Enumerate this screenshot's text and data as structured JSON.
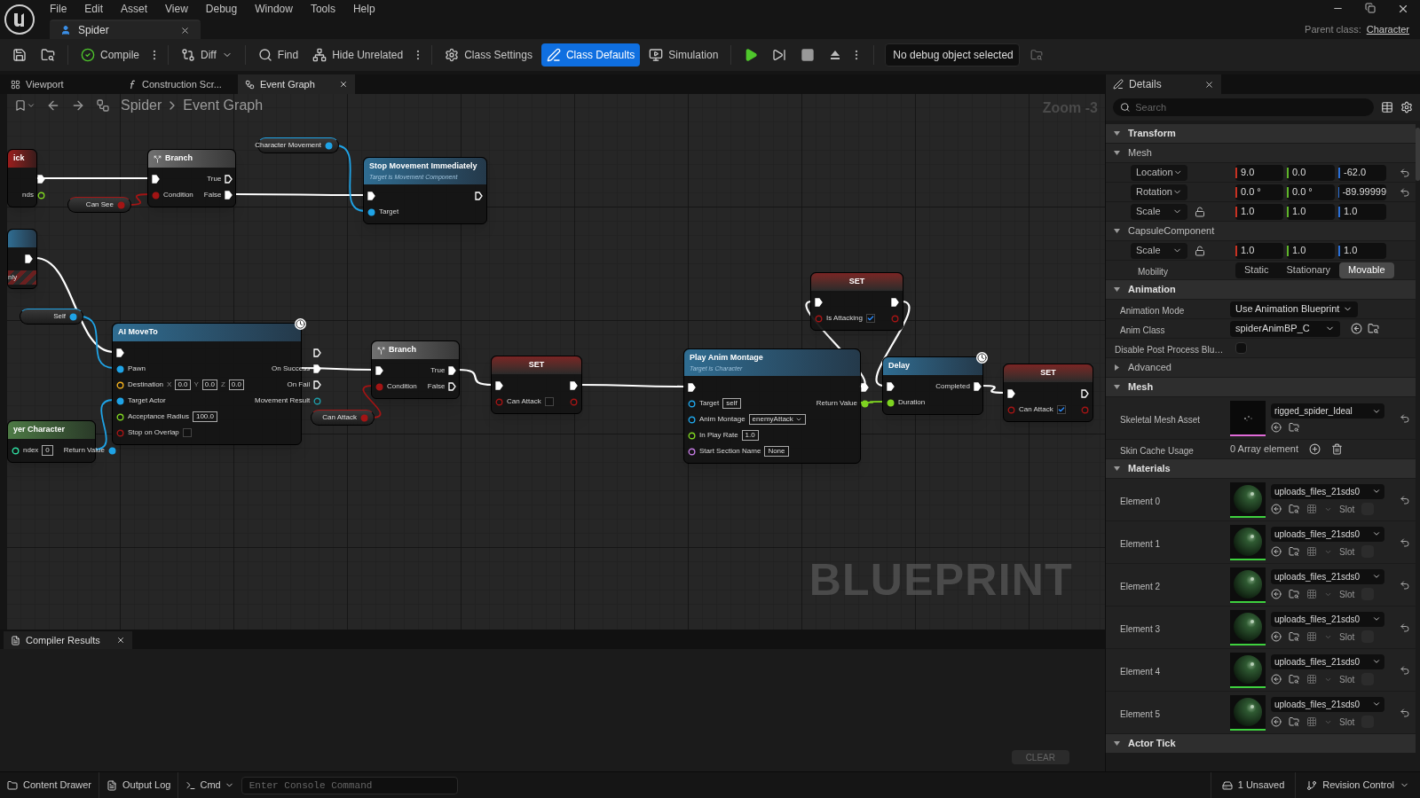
{
  "menu": [
    "File",
    "Edit",
    "Asset",
    "View",
    "Debug",
    "Window",
    "Tools",
    "Help"
  ],
  "document_tab": {
    "title": "Spider"
  },
  "parent_class": {
    "label": "Parent class:",
    "value": "Character"
  },
  "toolbar": {
    "buttons": [
      {
        "kind": "save",
        "active": false
      },
      {
        "kind": "browse",
        "active": false
      },
      {
        "kind": "compile",
        "label": "Compile",
        "active": false,
        "menu": true
      },
      {
        "kind": "diff",
        "label": "Diff",
        "active": false,
        "dropdown": true
      },
      {
        "kind": "find",
        "label": "Find",
        "active": false
      },
      {
        "kind": "hide",
        "label": "Hide Unrelated",
        "active": false,
        "menu": true
      },
      {
        "kind": "settings",
        "label": "Class Settings",
        "active": false
      },
      {
        "kind": "defaults",
        "label": "Class Defaults",
        "active": true
      },
      {
        "kind": "simulation",
        "label": "Simulation",
        "active": false
      },
      {
        "kind": "play",
        "active": false
      },
      {
        "kind": "step",
        "active": false
      },
      {
        "kind": "stop",
        "active": false
      },
      {
        "kind": "eject",
        "active": false,
        "menu": true
      }
    ],
    "debug_object": "No debug object selected"
  },
  "editor_tabs": [
    {
      "kind": "viewport",
      "label": "Viewport",
      "selected": false
    },
    {
      "kind": "function",
      "label": "Construction Scr...",
      "selected": false
    },
    {
      "kind": "graph",
      "label": "Event Graph",
      "selected": true,
      "closable": true
    }
  ],
  "graph": {
    "breadcrumb": [
      "Spider",
      "Event Graph"
    ],
    "zoom": "Zoom -3",
    "watermark": "BLUEPRINT",
    "nodes": [
      {
        "kind": "event",
        "title": "ick",
        "outputs": [
          {
            "kind": "exec",
            "linked": true
          },
          {
            "kind": "float",
            "label": "nds",
            "linked": false
          }
        ]
      },
      {
        "kind": "branch",
        "title": "Branch",
        "inputs": [
          {
            "kind": "exec",
            "linked": true
          },
          {
            "kind": "bool",
            "label": "Condition",
            "linked": true
          }
        ],
        "outputs": [
          {
            "kind": "exec",
            "label": "True",
            "linked": false
          },
          {
            "kind": "exec",
            "label": "False",
            "linked": true
          }
        ]
      },
      {
        "kind": "variable",
        "title": "Character Movement",
        "outputs": [
          {
            "kind": "object",
            "linked": true
          }
        ]
      },
      {
        "kind": "function",
        "title": "Stop Movement Immediately",
        "subtitle": "Target is Movement Component",
        "inputs": [
          {
            "kind": "exec",
            "linked": true
          },
          {
            "kind": "object",
            "label": "Target",
            "linked": true
          }
        ],
        "outputs": [
          {
            "kind": "exec",
            "linked": false
          }
        ]
      },
      {
        "kind": "variable",
        "title": "Can See",
        "outputs": [
          {
            "kind": "bool",
            "linked": true
          }
        ]
      },
      {
        "kind": "function",
        "banner": "nly",
        "outputs": [
          {
            "kind": "exec",
            "linked": true
          }
        ]
      },
      {
        "kind": "variable",
        "title": "Self",
        "outputs": [
          {
            "kind": "object",
            "linked": true
          }
        ]
      },
      {
        "kind": "function",
        "title": "AI MoveTo",
        "latent": true,
        "inputs": [
          {
            "kind": "exec",
            "linked": true
          },
          {
            "kind": "object",
            "label": "Pawn",
            "linked": true
          },
          {
            "kind": "vector",
            "label": "Destination",
            "linked": false,
            "values": [
              {
                "axis": "X",
                "value": "0.0"
              },
              {
                "axis": "Y",
                "value": "0.0"
              },
              {
                "axis": "Z",
                "value": "0.0"
              }
            ]
          },
          {
            "kind": "object",
            "label": "Target Actor",
            "linked": true
          },
          {
            "kind": "float",
            "label": "Acceptance Radius",
            "linked": false,
            "value": "100.0"
          },
          {
            "kind": "bool",
            "label": "Stop on Overlap",
            "linked": false,
            "checked": false
          }
        ],
        "outputs": [
          {
            "kind": "exec",
            "linked": false
          },
          {
            "kind": "exec",
            "label": "On Success",
            "linked": true
          },
          {
            "kind": "exec",
            "label": "On Fail",
            "linked": false
          },
          {
            "kind": "enum",
            "label": "Movement Result",
            "linked": false
          }
        ]
      },
      {
        "kind": "pure",
        "title": "yer Character",
        "inputs": [
          {
            "kind": "int",
            "label": "ndex",
            "linked": false,
            "value": "0"
          }
        ],
        "outputs": [
          {
            "kind": "object",
            "label": "Return Value",
            "linked": true
          }
        ]
      },
      {
        "kind": "variable",
        "title": "Can Attack",
        "outputs": [
          {
            "kind": "bool",
            "linked": true
          }
        ]
      },
      {
        "kind": "branch",
        "title": "Branch",
        "inputs": [
          {
            "kind": "exec",
            "linked": true
          },
          {
            "kind": "bool",
            "label": "Condition",
            "linked": true
          }
        ],
        "outputs": [
          {
            "kind": "exec",
            "label": "True",
            "linked": true
          },
          {
            "kind": "exec",
            "label": "False",
            "linked": false
          }
        ]
      },
      {
        "kind": "set",
        "title": "SET",
        "inputs": [
          {
            "kind": "exec",
            "linked": true
          },
          {
            "kind": "bool",
            "label": "Can Attack",
            "linked": false,
            "checked": false
          }
        ],
        "outputs": [
          {
            "kind": "exec",
            "linked": true
          },
          {
            "kind": "bool",
            "linked": false
          }
        ]
      },
      {
        "kind": "set",
        "title": "SET",
        "inputs": [
          {
            "kind": "exec",
            "linked": true
          },
          {
            "kind": "bool",
            "label": "Is Attacking",
            "linked": false,
            "checked": true
          }
        ],
        "outputs": [
          {
            "kind": "exec",
            "linked": true
          },
          {
            "kind": "bool",
            "linked": false
          }
        ]
      },
      {
        "kind": "function",
        "title": "Play Anim Montage",
        "subtitle": "Target is Character",
        "inputs": [
          {
            "kind": "exec",
            "linked": true
          },
          {
            "kind": "object",
            "label": "Target",
            "linked": false,
            "value": "self"
          },
          {
            "kind": "object",
            "label": "Anim Montage",
            "linked": false,
            "value": "enemyAttack",
            "picker": true
          },
          {
            "kind": "float",
            "label": "In Play Rate",
            "linked": false,
            "value": "1.0"
          },
          {
            "kind": "name",
            "label": "Start Section Name",
            "linked": false,
            "value": "None"
          }
        ],
        "outputs": [
          {
            "kind": "exec",
            "linked": true
          },
          {
            "kind": "float",
            "label": "Return Value",
            "linked": true
          }
        ]
      },
      {
        "kind": "function",
        "title": "Delay",
        "latent": true,
        "inputs": [
          {
            "kind": "exec",
            "linked": true
          },
          {
            "kind": "float",
            "label": "Duration",
            "linked": true
          }
        ],
        "outputs": [
          {
            "kind": "exec",
            "label": "Completed",
            "linked": true
          }
        ]
      },
      {
        "kind": "set",
        "title": "SET",
        "inputs": [
          {
            "kind": "exec",
            "linked": true
          },
          {
            "kind": "bool",
            "label": "Can Attack",
            "linked": false,
            "checked": true
          }
        ],
        "outputs": [
          {
            "kind": "exec",
            "linked": false
          },
          {
            "kind": "bool",
            "linked": false
          }
        ]
      }
    ]
  },
  "bottom_panel": {
    "tab": "Compiler Results",
    "clear": "CLEAR"
  },
  "details": {
    "title": "Details",
    "search_placeholder": "Search",
    "sections": [
      {
        "kind": "category",
        "title": "Transform",
        "expanded": true
      },
      {
        "kind": "group",
        "title": "Mesh",
        "expanded": true,
        "rows": [
          {
            "kind": "vector",
            "label": "Location",
            "values": [
              "9.0",
              "0.0",
              "-62.0"
            ],
            "reset": true,
            "lock": false
          },
          {
            "kind": "vector",
            "label": "Rotation",
            "values": [
              "0.0 °",
              "0.0 °",
              "-89.99999"
            ],
            "reset": true,
            "lock": false
          },
          {
            "kind": "vector",
            "label": "Scale",
            "values": [
              "1.0",
              "1.0",
              "1.0"
            ],
            "reset": false,
            "lock": true
          }
        ]
      },
      {
        "kind": "group",
        "title": "CapsuleComponent",
        "expanded": true,
        "rows": [
          {
            "kind": "vector",
            "label": "Scale",
            "values": [
              "1.0",
              "1.0",
              "1.0"
            ],
            "reset": false,
            "lock": true
          },
          {
            "kind": "segmented",
            "label": "Mobility",
            "options": [
              {
                "label": "Static",
                "selected": false
              },
              {
                "label": "Stationary",
                "selected": false
              },
              {
                "label": "Movable",
                "selected": true
              }
            ]
          }
        ]
      },
      {
        "kind": "category",
        "title": "Animation",
        "expanded": true,
        "rows": [
          {
            "kind": "dropdown",
            "label": "Animation Mode",
            "value": "Use Animation Blueprint"
          },
          {
            "kind": "class",
            "label": "Anim Class",
            "value": "spiderAnimBP_C"
          },
          {
            "kind": "checkbox",
            "label": "Disable Post Process Blu…",
            "checked": false
          }
        ]
      },
      {
        "kind": "group",
        "title": "Advanced",
        "expanded": false
      },
      {
        "kind": "category",
        "title": "Mesh",
        "expanded": true,
        "rows": [
          {
            "kind": "asset",
            "label": "Skeletal Mesh Asset",
            "value": "rigged_spider_Ideal",
            "reset": true
          },
          {
            "kind": "array",
            "label": "Skin Cache Usage",
            "value": "0 Array element"
          }
        ]
      },
      {
        "kind": "category",
        "title": "Materials",
        "expanded": true,
        "rows": [
          {
            "kind": "material",
            "label": "Element 0",
            "value": "uploads_files_21sds0",
            "slot": "Slot",
            "reset": true
          },
          {
            "kind": "material",
            "label": "Element 1",
            "value": "uploads_files_21sds0",
            "slot": "Slot",
            "reset": true
          },
          {
            "kind": "material",
            "label": "Element 2",
            "value": "uploads_files_21sds0",
            "slot": "Slot",
            "reset": true
          },
          {
            "kind": "material",
            "label": "Element 3",
            "value": "uploads_files_21sds0",
            "slot": "Slot",
            "reset": true
          },
          {
            "kind": "material",
            "label": "Element 4",
            "value": "uploads_files_21sds0",
            "slot": "Slot",
            "reset": true
          },
          {
            "kind": "material",
            "label": "Element 5",
            "value": "uploads_files_21sds0",
            "slot": "Slot",
            "reset": true
          }
        ]
      },
      {
        "kind": "category",
        "title": "Actor Tick",
        "expanded": true
      }
    ]
  },
  "status_bar": {
    "content_drawer": "Content Drawer",
    "output_log": "Output Log",
    "cmd": "Cmd",
    "console_placeholder": "Enter Console Command",
    "unsaved": "1 Unsaved",
    "revision_control": "Revision Control"
  }
}
